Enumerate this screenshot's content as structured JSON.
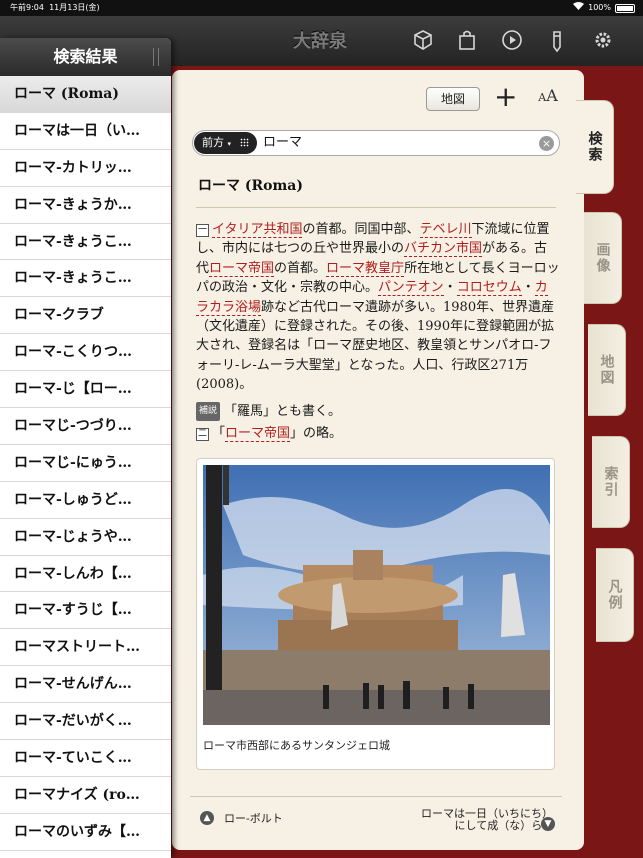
{
  "status_bar": {
    "time": "午前9:04",
    "date": "11月13日(金)",
    "battery_percent": "100%"
  },
  "toolbar": {
    "title": "大辞泉",
    "icons": [
      "cube-icon",
      "bag-icon",
      "play-icon",
      "pencil-icon",
      "gear-icon"
    ]
  },
  "sidebar": {
    "title": "検索結果",
    "items": [
      "ローマ (Roma)",
      "ローマは一日（い…",
      "ローマ-カトリッ…",
      "ローマ-きょうか…",
      "ローマ-きょうこ…",
      "ローマ-きょうこ…",
      "ローマ-クラブ",
      "ローマ-こくりつ…",
      "ローマ-じ【ロー…",
      "ローマじ-つづり…",
      "ローマじ-にゅう…",
      "ローマ-しゅうど…",
      "ローマ-じょうや…",
      "ローマ-しんわ【…",
      "ローマ-すうじ【…",
      "ローマストリート…",
      "ローマ-せんげん…",
      "ローマ-だいがく…",
      "ローマ-ていこく…",
      "ローマナイズ (ro…",
      "ローマのいずみ【…"
    ],
    "selected_index": 0
  },
  "controls": {
    "map_button": "地図",
    "plus": "+",
    "font_size": "AA"
  },
  "search": {
    "scope": "前方",
    "query": "ローマ"
  },
  "side_tabs": [
    "検索",
    "画像",
    "地図",
    "索引",
    "凡例"
  ],
  "entry": {
    "title": "ローマ (Roma)",
    "def1_num": "一",
    "def1": {
      "l1": "イタリア共和国",
      "t1": "の首都。同国中部、",
      "l2": "テベレ川",
      "t2": "下流域に位置し、市内には七つの丘や世界最小の",
      "l3": "バチカン市国",
      "t3": "がある。古代",
      "l4": "ローマ帝国",
      "t4": "の首都。",
      "l5": "ローマ教皇庁",
      "t5": "所在地として長くヨーロッパの政治・文化・宗教の中心。",
      "l6": "パンテオン",
      "t6": "・",
      "l7": "コロセウム",
      "t7": "・",
      "l8": "カラカラ浴場",
      "t8": "跡など古代ローマ遺跡が多い。1980年、世界遺産（文化遺産）に登録された。その後、1990年に登録範囲が拡大され、登録名は「ローマ歴史地区、教皇領とサンパオロ-フォーリ-レ-ムーラ大聖堂」となった。人口、行政区271万(2008)。"
    },
    "note_badge": "補説",
    "note": "「羅馬」とも書く。",
    "def2_num": "二",
    "def2_pre": "「",
    "def2_link": "ローマ帝国",
    "def2_post": "」の略。",
    "photo_caption": "ローマ市西部にあるサンタンジェロ城"
  },
  "bottom_nav": {
    "prev": "ロー-ボルト",
    "next_line1": "ローマは一日（いちにち）",
    "next_line2": "にして成（な）らず"
  }
}
